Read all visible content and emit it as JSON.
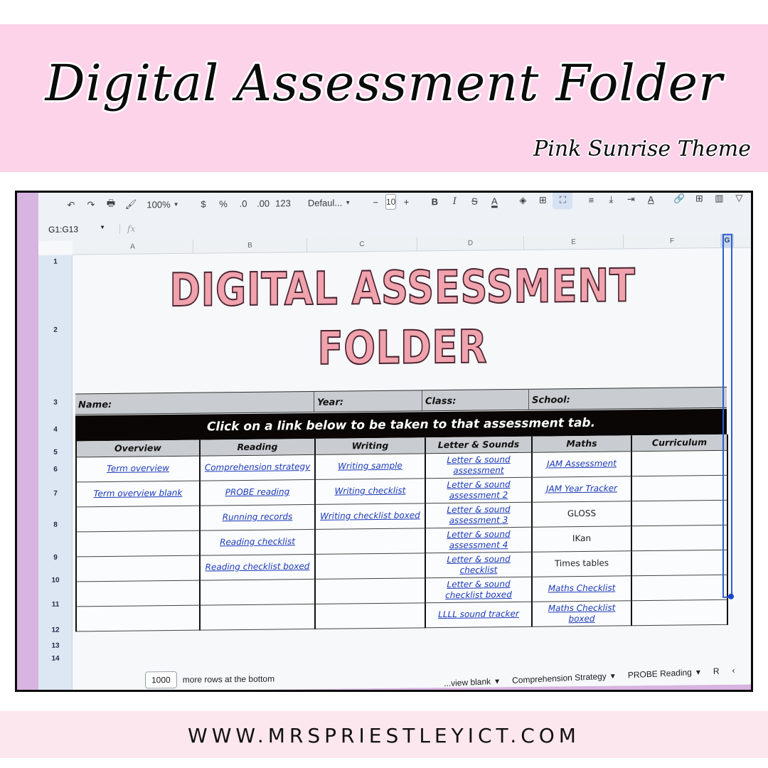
{
  "banner": {
    "title": "Digital Assessment Folder",
    "subtitle": "Pink Sunrise Theme",
    "bg_color": "#fdd3ea"
  },
  "toolbar": {
    "undo": "↶",
    "redo": "↷",
    "print": "🖶",
    "paint_format": "🖌",
    "zoom": "100%",
    "currency": "$",
    "percent": "%",
    "decrease_decimal": ".0",
    "increase_decimal": ".00",
    "number_format": "123",
    "font": "Defaul...",
    "font_size_minus": "−",
    "font_size": "10",
    "font_size_plus": "+",
    "bold": "B",
    "italic": "I",
    "strikethrough": "S",
    "text_color": "A",
    "fill": "◈",
    "borders": "⊞",
    "merge": "⛶",
    "align": "≡",
    "valign": "⤓",
    "wrap": "⇥",
    "rotate": "A",
    "link": "🔗",
    "comment": "⊞",
    "chart": "▥",
    "filter": "▽",
    "functions": "▤"
  },
  "formula_bar": {
    "name_box": "G1:G13",
    "fx": "fx",
    "value": ""
  },
  "columns": [
    "A",
    "B",
    "C",
    "D",
    "E",
    "F",
    "G"
  ],
  "rows": [
    "1",
    "2",
    "3",
    "4",
    "5",
    "6",
    "7",
    "8",
    "9",
    "10",
    "11",
    "12",
    "13",
    "14"
  ],
  "sheet": {
    "title_line1": "DIGITAL ASSESSMENT",
    "title_line2": "FOLDER",
    "title_color": "#f0a2ad",
    "info": {
      "name": "Name:",
      "year": "Year:",
      "class": "Class:",
      "school": "School:"
    },
    "instruction": "Click on a link below to be taken to that assessment tab.",
    "headers": [
      "Overview",
      "Reading",
      "Writing",
      "Letter & Sounds",
      "Maths",
      "Curriculum"
    ],
    "table_rows": [
      [
        {
          "text": "Term overview",
          "link": true
        },
        {
          "text": "Comprehension strategy",
          "link": true
        },
        {
          "text": "Writing sample",
          "link": true
        },
        {
          "text": "Letter & sound assessment",
          "link": true
        },
        {
          "text": "JAM Assessment",
          "link": true
        },
        {
          "text": "",
          "link": false
        }
      ],
      [
        {
          "text": "Term overview blank",
          "link": true
        },
        {
          "text": "PROBE reading",
          "link": true
        },
        {
          "text": "Writing checklist",
          "link": true
        },
        {
          "text": "Letter & sound assessment 2",
          "link": true
        },
        {
          "text": "JAM Year Tracker",
          "link": true
        },
        {
          "text": "",
          "link": false
        }
      ],
      [
        {
          "text": "",
          "link": false
        },
        {
          "text": "Running records",
          "link": true
        },
        {
          "text": "Writing checklist boxed",
          "link": true
        },
        {
          "text": "Letter & sound assessment 3",
          "link": true
        },
        {
          "text": "GLOSS",
          "link": false
        },
        {
          "text": "",
          "link": false
        }
      ],
      [
        {
          "text": "",
          "link": false
        },
        {
          "text": "Reading checklist",
          "link": true
        },
        {
          "text": "",
          "link": false
        },
        {
          "text": "Letter & sound assessment 4",
          "link": true
        },
        {
          "text": "IKan",
          "link": false
        },
        {
          "text": "",
          "link": false
        }
      ],
      [
        {
          "text": "",
          "link": false
        },
        {
          "text": "Reading checklist boxed",
          "link": true
        },
        {
          "text": "",
          "link": false
        },
        {
          "text": "Letter & sound checklist",
          "link": true
        },
        {
          "text": "Times tables",
          "link": false
        },
        {
          "text": "",
          "link": false
        }
      ],
      [
        {
          "text": "",
          "link": false
        },
        {
          "text": "",
          "link": false
        },
        {
          "text": "",
          "link": false
        },
        {
          "text": "Letter & sound checklist boxed",
          "link": true
        },
        {
          "text": "Maths Checklist",
          "link": true
        },
        {
          "text": "",
          "link": false
        }
      ],
      [
        {
          "text": "",
          "link": false
        },
        {
          "text": "",
          "link": false
        },
        {
          "text": "",
          "link": false
        },
        {
          "text": "LLLL sound tracker",
          "link": true
        },
        {
          "text": "Maths Checklist boxed",
          "link": true
        },
        {
          "text": "",
          "link": false
        }
      ]
    ]
  },
  "footer": {
    "add_rows_count": "1000",
    "add_rows_label": "more rows at the bottom",
    "tabs": [
      "...view blank",
      "Comprehension Strategy",
      "PROBE Reading",
      "R"
    ],
    "tab_caret": "▾",
    "scroll_left": "‹"
  },
  "url": "WWW.MRSPRIESTLEYICT.COM"
}
